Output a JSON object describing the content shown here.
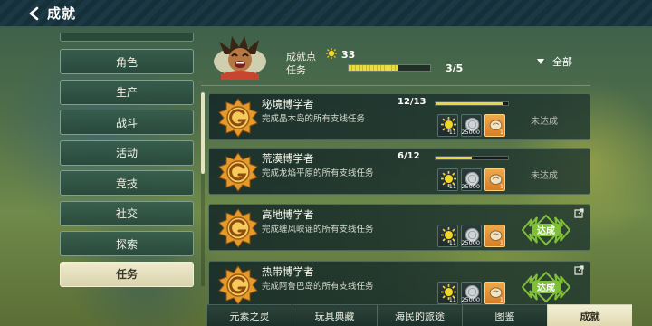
{
  "window": {
    "title": "成就"
  },
  "sidebar": {
    "items": [
      {
        "label": "角色"
      },
      {
        "label": "生产"
      },
      {
        "label": "战斗"
      },
      {
        "label": "活动"
      },
      {
        "label": "竞技"
      },
      {
        "label": "社交"
      },
      {
        "label": "探索"
      },
      {
        "label": "任务"
      }
    ],
    "active_index": 7
  },
  "header": {
    "points_label": "成就点",
    "points_value": "33",
    "task_label": "任务",
    "task_count": "3/5",
    "task_fraction": 0.6,
    "filter_label": "全部"
  },
  "achievements": [
    {
      "name": "秘境博学者",
      "desc": "完成晶木岛的所有支线任务",
      "progress": "12/13",
      "fraction": 0.92,
      "rewards": {
        "star_qty": "11",
        "coin_qty": "25000",
        "item_qty": "1"
      },
      "status": "未达成"
    },
    {
      "name": "荒漠博学者",
      "desc": "完成龙焰平原的所有支线任务",
      "progress": "6/12",
      "fraction": 0.5,
      "rewards": {
        "star_qty": "11",
        "coin_qty": "25000",
        "item_qty": "1"
      },
      "status": "未达成"
    },
    {
      "name": "高地博学者",
      "desc": "完成缠风峡谣的所有支线任务",
      "progress": "",
      "fraction": 1,
      "rewards": {
        "star_qty": "11",
        "coin_qty": "25000",
        "item_qty": "1"
      },
      "status": "达成"
    },
    {
      "name": "热带博学者",
      "desc": "完成阿鲁巴岛的所有支线任务",
      "progress": "",
      "fraction": 1,
      "rewards": {
        "star_qty": "11",
        "coin_qty": "25000",
        "item_qty": "1"
      },
      "status": "达成"
    }
  ],
  "tabs": [
    {
      "label": "元素之灵"
    },
    {
      "label": "玩具典藏"
    },
    {
      "label": "海民的旅途"
    },
    {
      "label": "图鉴"
    },
    {
      "label": "成就"
    }
  ],
  "colors": {
    "accent_yellow": "#e7d93c",
    "stamp_green": "#7fbf3a",
    "active_tab": "#f3efd4"
  }
}
